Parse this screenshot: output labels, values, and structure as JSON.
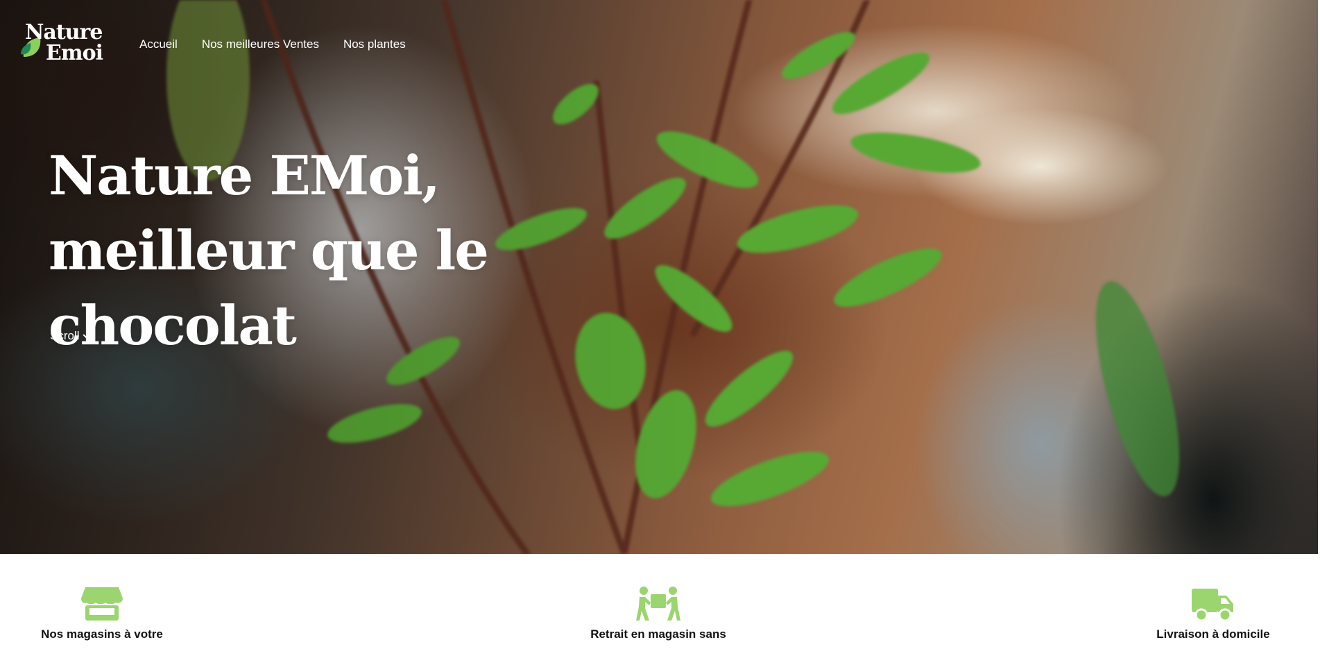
{
  "brand": {
    "logo_line1": "Nature",
    "logo_line2": "Emoi",
    "accent_color": "#9bd56f"
  },
  "nav": {
    "items": [
      {
        "label": "Accueil"
      },
      {
        "label": "Nos meilleures Ventes"
      },
      {
        "label": "Nos plantes"
      }
    ]
  },
  "hero": {
    "title": "Nature EMoi, meilleur que le chocolat",
    "scroll_label": "Scroll",
    "scroll_icon": "chevron-down-icon"
  },
  "features": [
    {
      "icon": "store-icon",
      "label": "Nos magasins à votre"
    },
    {
      "icon": "people-carry-box-icon",
      "label": "Retrait en magasin sans"
    },
    {
      "icon": "truck-icon",
      "label": "Livraison à domicile"
    }
  ]
}
